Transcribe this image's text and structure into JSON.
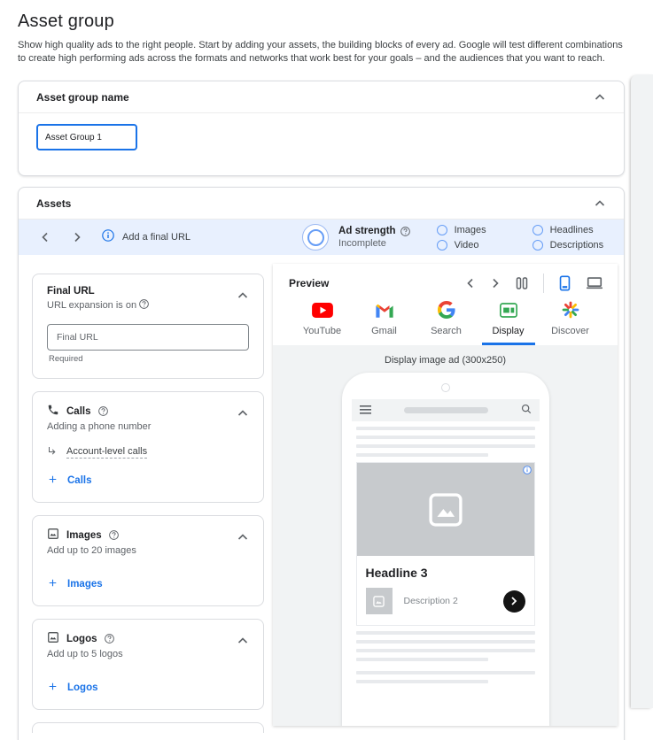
{
  "page": {
    "title": "Asset group",
    "description": "Show high quality ads to the right people. Start by adding your assets, the building blocks of every ad. Google will test different combinations to create high performing ads across the formats and networks that work best for your goals – and the audiences that you want to reach."
  },
  "name_card": {
    "header": "Asset group name",
    "value": "Asset Group 1"
  },
  "assets": {
    "header": "Assets",
    "toolbar": {
      "add_final_url": "Add a final URL",
      "ad_strength_label": "Ad strength",
      "ad_strength_status": "Incomplete",
      "checks": [
        "Images",
        "Video",
        "Headlines",
        "Descriptions"
      ]
    },
    "final_url_card": {
      "title": "Final URL",
      "subtitle": "URL expansion is on",
      "placeholder": "Final URL",
      "helper": "Required"
    },
    "calls_card": {
      "title": "Calls",
      "subtitle": "Adding a phone number",
      "account_link": "Account-level calls",
      "add_label": "Calls"
    },
    "images_card": {
      "title": "Images",
      "subtitle": "Add up to 20 images",
      "add_label": "Images"
    },
    "logos_card": {
      "title": "Logos",
      "subtitle": "Add up to 5 logos",
      "add_label": "Logos"
    },
    "preview": {
      "title": "Preview",
      "tabs": [
        {
          "label": "YouTube"
        },
        {
          "label": "Gmail"
        },
        {
          "label": "Search"
        },
        {
          "label": "Display"
        },
        {
          "label": "Discover"
        }
      ],
      "active_tab": "Display",
      "format_label": "Display image ad (300x250)",
      "ad": {
        "headline": "Headline 3",
        "description": "Description 2"
      }
    }
  },
  "colors": {
    "accent_blue": "#1a73e8",
    "toolbar_bg": "#e8f0fe",
    "preview_bg": "#f1f3f4",
    "skeleton": "#e8eaed",
    "placeholder_gray": "#c7cacd"
  }
}
